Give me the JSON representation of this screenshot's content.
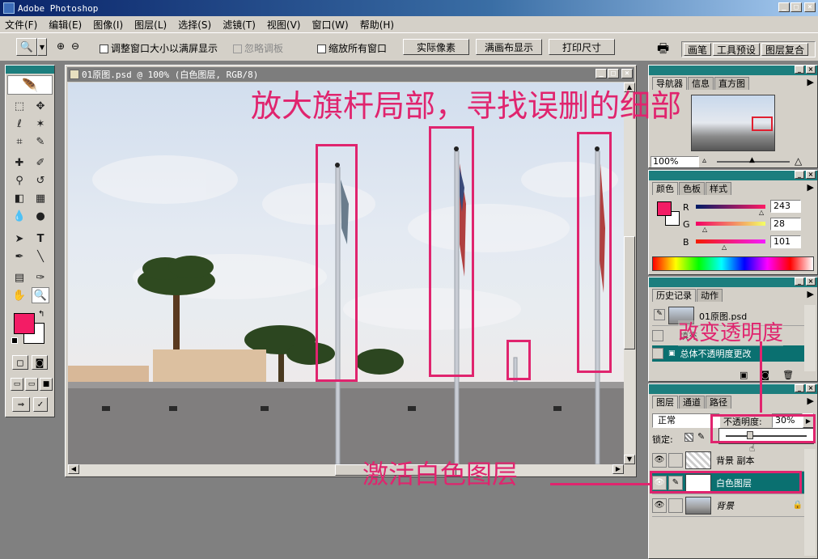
{
  "app": {
    "title": "Adobe Photoshop"
  },
  "menu": [
    "文件(F)",
    "编辑(E)",
    "图像(I)",
    "图层(L)",
    "选择(S)",
    "滤镜(T)",
    "视图(V)",
    "窗口(W)",
    "帮助(H)"
  ],
  "options": {
    "resize_window": "调整窗口大小以满屏显示",
    "ignore_palettes": "忽略调板",
    "zoom_all": "缩放所有窗口",
    "actual_pixels": "实际像素",
    "fit_screen": "满画布显示",
    "print_size": "打印尺寸",
    "palette_tabs": [
      "画笔",
      "工具预设",
      "图层复合"
    ]
  },
  "document": {
    "title": "01原图.psd @ 100% (白色图层, RGB/8)"
  },
  "navigator": {
    "tabs": [
      "导航器",
      "信息",
      "直方图"
    ],
    "zoom": "100%"
  },
  "color": {
    "tabs": [
      "颜色",
      "色板",
      "样式"
    ],
    "r_label": "R",
    "g_label": "G",
    "b_label": "B",
    "r": "243",
    "g": "28",
    "b": "101",
    "fg": "#f31c65"
  },
  "history": {
    "tabs": [
      "历史记录",
      "动作"
    ],
    "snapshot": "01原图.psd",
    "items": [
      "填充",
      "总体不透明度更改"
    ]
  },
  "layers": {
    "tabs": [
      "图层",
      "通道",
      "路径"
    ],
    "blend": "正常",
    "opacity_label": "不透明度:",
    "opacity": "30%",
    "opacity_fraction": 0.3,
    "lock_label": "锁定:",
    "items": [
      "背景 副本",
      "白色图层",
      "背景"
    ]
  },
  "annotations": {
    "headline": "放大旗杆局部，寻找误删的细部",
    "opacity_note": "改变透明度",
    "activate_note": "激活白色图层"
  }
}
